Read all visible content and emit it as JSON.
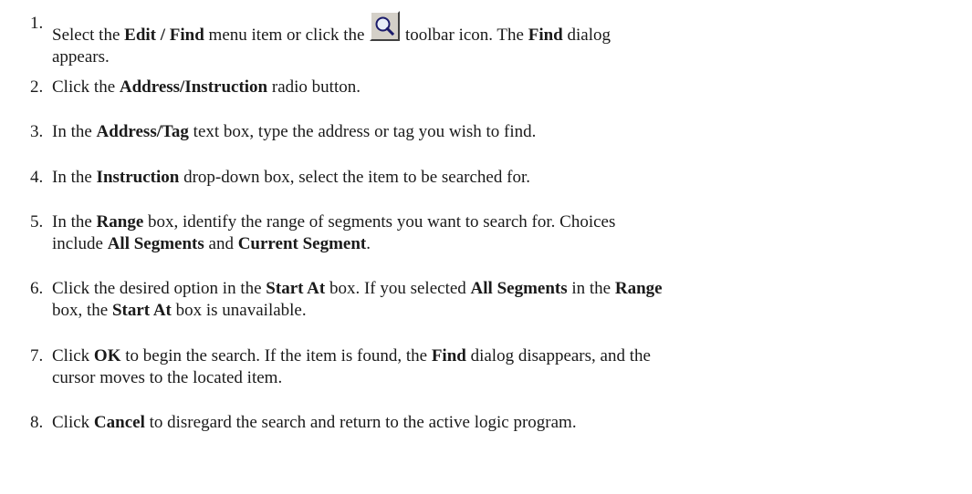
{
  "toolbar_icon": "magnifier-find-icon",
  "steps": [
    {
      "number": "1.",
      "t1": "Select the ",
      "b1": "Edit / Find",
      "t2": " menu item or click the ",
      "t3": " toolbar icon. The ",
      "b2": "Find",
      "t4": " dialog",
      "t5": "appears."
    },
    {
      "number": "2.",
      "t1": "Click the ",
      "b1": "Address/Instruction",
      "t2": " radio button."
    },
    {
      "number": "3.",
      "t1": "In the ",
      "b1": "Address/Tag",
      "t2": " text box, type the address or tag you wish to find."
    },
    {
      "number": "4.",
      "t1": "In the ",
      "b1": "Instruction",
      "t2": " drop-down box, select the item to be searched for."
    },
    {
      "number": "5.",
      "t1": "In the ",
      "b1": "Range",
      "t2": " box, identify the range of segments you want to search for. Choices",
      "t3": "include ",
      "b2": "All Segments",
      "t4": " and ",
      "b3": "Current Segment",
      "t5": "."
    },
    {
      "number": "6.",
      "t1": "Click the desired option in the ",
      "b1": "Start At",
      "t2": " box. If you selected ",
      "b2": "All Segments",
      "t3": " in the ",
      "b3": "Range",
      "t4": "box, the ",
      "b4": "Start At",
      "t5": " box is unavailable."
    },
    {
      "number": "7.",
      "t1": "Click ",
      "b1": "OK",
      "t2": " to begin the search. If the item is found, the ",
      "b2": "Find",
      "t3": " dialog disappears, and the",
      "t4": "cursor moves to the located item."
    },
    {
      "number": "8.",
      "t1": "Click ",
      "b1": "Cancel",
      "t2": " to disregard the search and return to the active logic program."
    }
  ]
}
